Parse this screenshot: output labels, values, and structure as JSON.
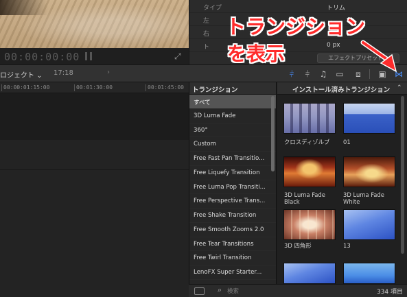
{
  "viewer": {
    "timecode": "00:00:00:00"
  },
  "inspector": {
    "rows": [
      {
        "label": "タイプ",
        "value": "トリム"
      },
      {
        "label": "左",
        "value": ""
      },
      {
        "label": "右",
        "value": ""
      },
      {
        "label": "ト",
        "value": "0 px"
      }
    ],
    "preset_button": "エフェクトプリセット..."
  },
  "annotation": {
    "line1": "トランジション",
    "line2": "を表示",
    "color": "#ff2b2b"
  },
  "toolbar": {
    "project_label": "ロジェクト",
    "project_time": "17:18",
    "accent_color": "#4a90ff"
  },
  "timeline": {
    "ruler_marks": [
      "00:00:01:15:00",
      "00:01:30:00",
      "00:01:45:00"
    ]
  },
  "transitions_list": {
    "header": "トランジション",
    "items": [
      "すべて",
      "3D Luma Fade",
      "360°",
      "Custom",
      "Free Fast Pan Transitio...",
      "Free Liquefy Transition",
      "Free Luma Pop Transiti...",
      "Free Perspective Trans...",
      "Free Shake Transition",
      "Free Smooth Zooms 2.0",
      "Free Tear Transitions",
      "Free Twirl Transition",
      "LenoFX Super Starter..."
    ],
    "selected_index": 0
  },
  "grid": {
    "header": "インストール済みトランジション",
    "items": [
      {
        "label": "クロスディゾルブ",
        "style": "forest"
      },
      {
        "label": "01",
        "style": "blue"
      },
      {
        "label": "3D Luma Fade Black",
        "style": "fire"
      },
      {
        "label": "3D Luma Fade White",
        "style": "fire2"
      },
      {
        "label": "3D 四角形",
        "style": "corridor"
      },
      {
        "label": "13",
        "style": "blue2"
      },
      {
        "label": "",
        "style": "blue2"
      },
      {
        "label": "",
        "style": "cyan"
      }
    ]
  },
  "bottom_bar": {
    "search_placeholder": "検索",
    "item_count": "334 項目"
  }
}
